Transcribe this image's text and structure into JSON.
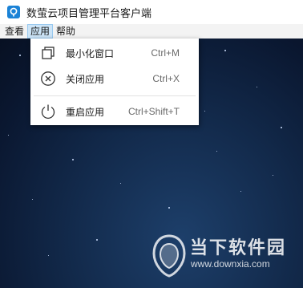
{
  "window": {
    "title": "数萤云项目管理平台客户端"
  },
  "menubar": {
    "items": [
      {
        "label": "查看"
      },
      {
        "label": "应用"
      },
      {
        "label": "帮助"
      }
    ],
    "active_index": 1
  },
  "app_menu": {
    "items": [
      {
        "icon": "restore-window-icon",
        "label": "最小化窗口",
        "shortcut": "Ctrl+M"
      },
      {
        "icon": "close-circle-icon",
        "label": "关闭应用",
        "shortcut": "Ctrl+X"
      },
      {
        "icon": "power-icon",
        "label": "重启应用",
        "shortcut": "Ctrl+Shift+T"
      }
    ]
  },
  "watermark": {
    "name": "当下软件园",
    "url": "www.downxia.com"
  },
  "colors": {
    "menu_highlight": "#cce4f7",
    "background_sky": "#12294a",
    "app_icon": "#1a82d6"
  }
}
